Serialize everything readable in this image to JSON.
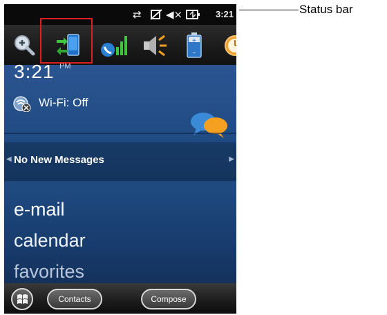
{
  "status_bar": {
    "icons": [
      "sync-arrows-icon",
      "signal-off-icon",
      "speaker-muted-icon",
      "battery-charging-icon"
    ],
    "time": "3:21"
  },
  "toolbar": {
    "icons": [
      "zoom-icon",
      "activesync-device-icon",
      "phone-signal-icon",
      "speaker-icon",
      "battery-icon",
      "clock-icon"
    ],
    "highlight_color": "#e02020"
  },
  "home": {
    "clock": "3:21",
    "clock_suffix": "PM",
    "wifi_icon": "wifi-off-icon",
    "wifi_label": "Wi-Fi: Off",
    "chat_icon": "chat-bubbles-icon",
    "messages_label": "No New Messages",
    "menu": [
      "e-mail",
      "calendar",
      "favorites"
    ]
  },
  "softkeys": {
    "start_icon": "windows-logo-icon",
    "left": "Contacts",
    "right": "Compose"
  },
  "callout": {
    "label": "Status bar"
  }
}
